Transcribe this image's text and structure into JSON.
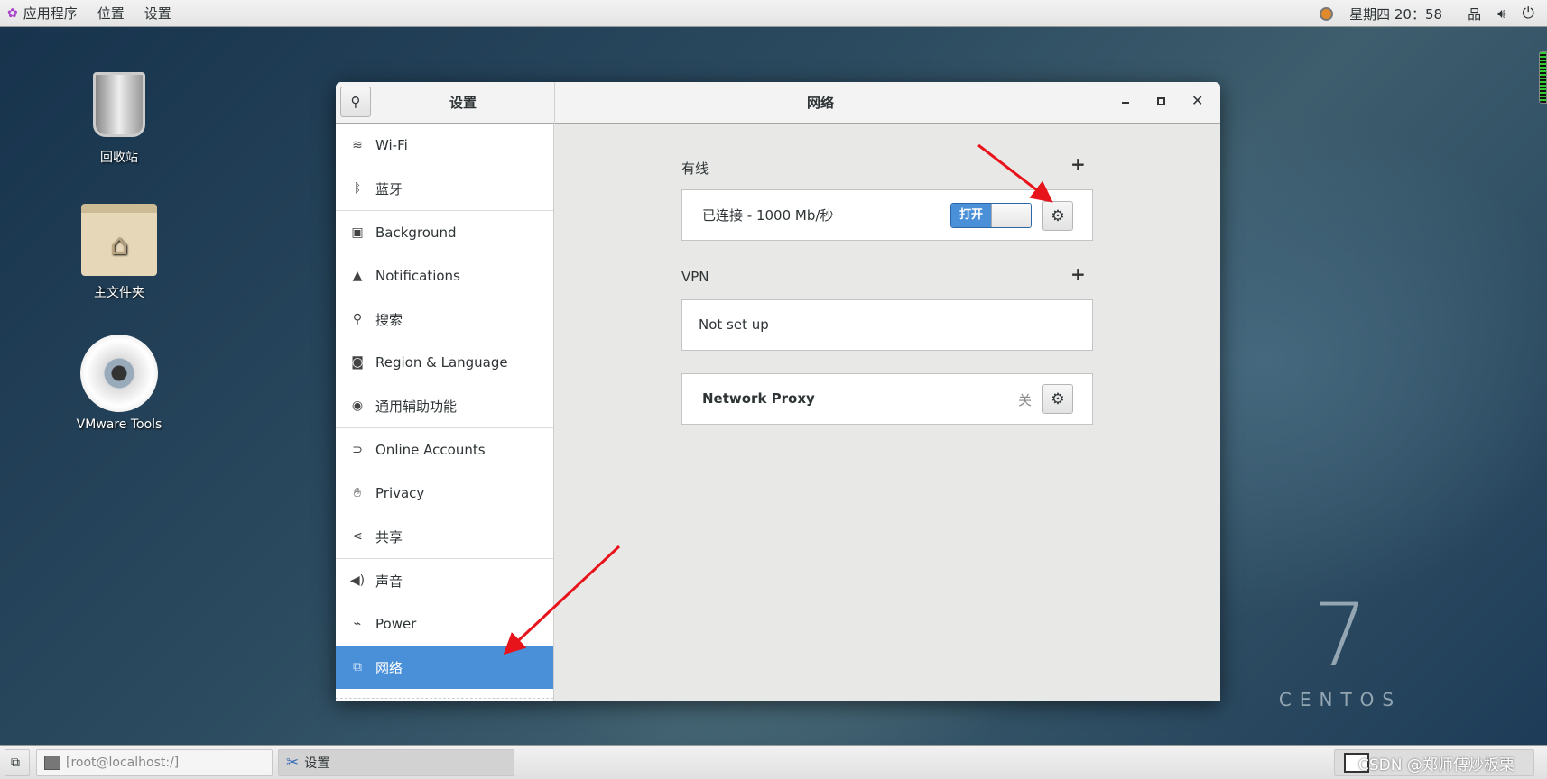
{
  "topbar": {
    "apps": "应用程序",
    "places": "位置",
    "settings": "设置",
    "clock": "星期四 20：58"
  },
  "desktop": {
    "trash": "回收站",
    "home": "主文件夹",
    "vmware": "VMware Tools"
  },
  "window": {
    "sidebar_title": "设置",
    "title": "网络"
  },
  "sidebar": {
    "items": [
      {
        "label": "Wi-Fi",
        "icon": "wifi-icon"
      },
      {
        "label": "蓝牙",
        "icon": "bluetooth-icon"
      },
      {
        "label": "Background",
        "icon": "background-icon"
      },
      {
        "label": "Notifications",
        "icon": "bell-icon"
      },
      {
        "label": "搜索",
        "icon": "search-icon"
      },
      {
        "label": "Region & Language",
        "icon": "region-icon"
      },
      {
        "label": "通用辅助功能",
        "icon": "accessibility-icon"
      },
      {
        "label": "Online Accounts",
        "icon": "online-accounts-icon"
      },
      {
        "label": "Privacy",
        "icon": "hand-icon"
      },
      {
        "label": "共享",
        "icon": "share-icon"
      },
      {
        "label": "声音",
        "icon": "speaker-icon"
      },
      {
        "label": "Power",
        "icon": "power-plug-icon"
      },
      {
        "label": "网络",
        "icon": "network-icon",
        "selected": true
      }
    ]
  },
  "network": {
    "wired_title": "有线",
    "wired_status": "已连接 - 1000 Mb/秒",
    "wired_switch": "打开",
    "wired_on": true,
    "vpn_title": "VPN",
    "vpn_status": "Not set up",
    "proxy_label": "Network Proxy",
    "proxy_state": "关"
  },
  "taskbar": {
    "terminal": "[root@localhost:/]",
    "settings": "设置",
    "watermark": "CSDN @郑师傅炒板栗"
  },
  "brand": {
    "number": "7",
    "name": "CENTOS"
  },
  "colors": {
    "accent": "#4a90d9",
    "arrow": "#e8141b"
  }
}
